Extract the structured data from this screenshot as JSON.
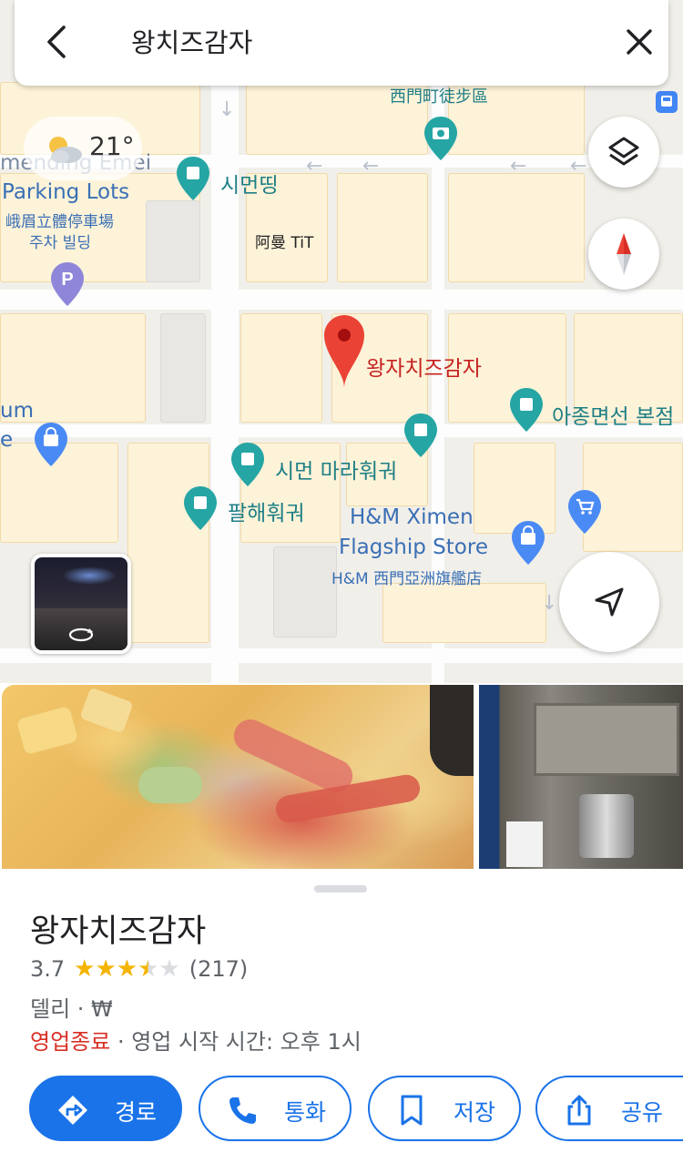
{
  "search": {
    "query": "왕치즈감자"
  },
  "weather": {
    "temperature": "21°",
    "icon": "partly-cloudy-icon"
  },
  "map": {
    "labels": {
      "ximending_pedestrian": "西門町徒步區",
      "emei_partial": "mending Emei",
      "parking_lots": "Parking Lots",
      "parking_zh": "峨眉立體停車場",
      "parking_ko": "주차 빌딩",
      "ximending_ko": "시먼띵",
      "amantit": "阿曼 TiT",
      "selected_place": "왕자치즈감자",
      "um_partial": "um",
      "e_partial": "e",
      "ajong": "아종면선 본점",
      "ximen_mala": "시먼 마라훠궈",
      "palhae": "팔해훠궈",
      "hm_line1": "H&M Ximen",
      "hm_line2": "Flagship Store",
      "hm_zh": "H&M 西門亞洲旗艦店"
    }
  },
  "place": {
    "name": "왕자치즈감자",
    "rating": "3.7",
    "rating_fraction": 0.74,
    "review_count": "(217)",
    "category": "델리 · ₩",
    "hours_status": "영업종료",
    "hours_detail": " · 영업 시작 시간: 오후 1시"
  },
  "actions": {
    "directions": "경로",
    "call": "통화",
    "save": "저장",
    "share": "공유"
  },
  "colors": {
    "accent": "#1a73e8",
    "pin": "#ea4335",
    "closed": "#d93025",
    "star": "#f4b400"
  }
}
